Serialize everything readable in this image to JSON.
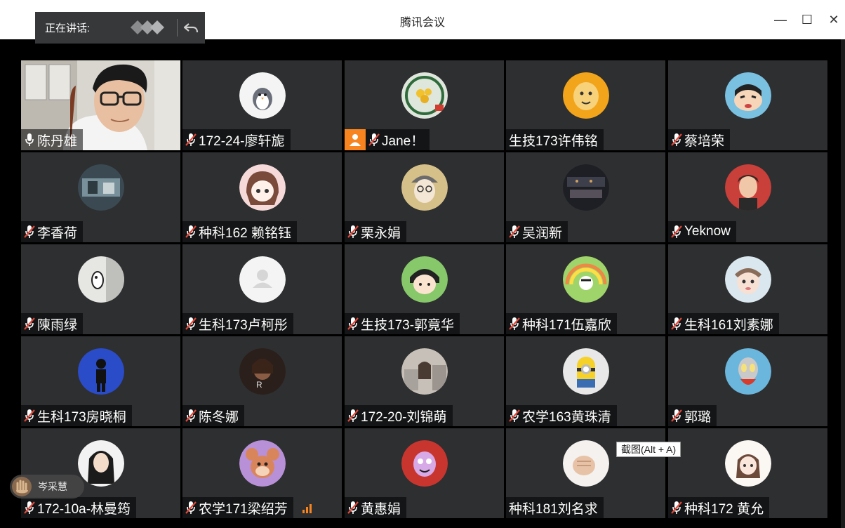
{
  "window": {
    "title": "腾讯会议",
    "minimize": "—",
    "maximize": "☐",
    "close": "✕"
  },
  "speaking": {
    "label": "正在讲话:"
  },
  "tooltip": "截图(Alt + A)",
  "raised_hand": {
    "name": "岑采慧"
  },
  "participants": [
    {
      "name": "陈丹雄",
      "mic": "on",
      "video": true
    },
    {
      "name": "172-24-廖轩旎",
      "mic": "off",
      "avatar": "penguin"
    },
    {
      "name": "Jane！",
      "mic": "off",
      "avatar": "sunflower",
      "host": true
    },
    {
      "name": "生技173许伟铭",
      "mic": "none",
      "avatar": "cartoon-yellow"
    },
    {
      "name": "蔡培荣",
      "mic": "off",
      "avatar": "crayon-shin"
    },
    {
      "name": "李香荷",
      "mic": "off",
      "avatar": "scene-dark"
    },
    {
      "name": "种科162 赖铭钰",
      "mic": "off",
      "avatar": "anime-girl"
    },
    {
      "name": "栗永娟",
      "mic": "off",
      "avatar": "girl-hat"
    },
    {
      "name": "吴润新",
      "mic": "off",
      "avatar": "night-scene"
    },
    {
      "name": "Yeknow",
      "mic": "off",
      "avatar": "portrait-red"
    },
    {
      "name": "陳雨绿",
      "mic": "off",
      "avatar": "sketch"
    },
    {
      "name": "生科173卢柯彤",
      "mic": "off",
      "avatar": "default"
    },
    {
      "name": "生技173-郭竟华",
      "mic": "off",
      "avatar": "maruko"
    },
    {
      "name": "种科171伍嘉欣",
      "mic": "off",
      "avatar": "rainbow"
    },
    {
      "name": "生科161刘素娜",
      "mic": "off",
      "avatar": "face-pink"
    },
    {
      "name": "生科173房晓桐",
      "mic": "off",
      "avatar": "blue-figure"
    },
    {
      "name": "陈冬娜",
      "mic": "off",
      "avatar": "dark-portrait"
    },
    {
      "name": "172-20-刘锦萌",
      "mic": "off",
      "avatar": "city-girl"
    },
    {
      "name": "农学163黄珠清",
      "mic": "off",
      "avatar": "minion"
    },
    {
      "name": "郭璐",
      "mic": "off",
      "avatar": "ultraman"
    },
    {
      "name": "172-10a-林曼筠",
      "mic": "off",
      "avatar": "long-hair"
    },
    {
      "name": "农学171梁绍芳",
      "mic": "off",
      "avatar": "jerry"
    },
    {
      "name": "黄惠娟",
      "mic": "off",
      "avatar": "cartoon-face"
    },
    {
      "name": "种科181刘名求",
      "mic": "none",
      "avatar": "fist"
    },
    {
      "name": "种科172 黄允",
      "mic": "off",
      "avatar": "doll"
    }
  ],
  "colors": {
    "tile": "#2e2f31",
    "host_badge": "#f7841e",
    "signal": "#f7841e"
  }
}
